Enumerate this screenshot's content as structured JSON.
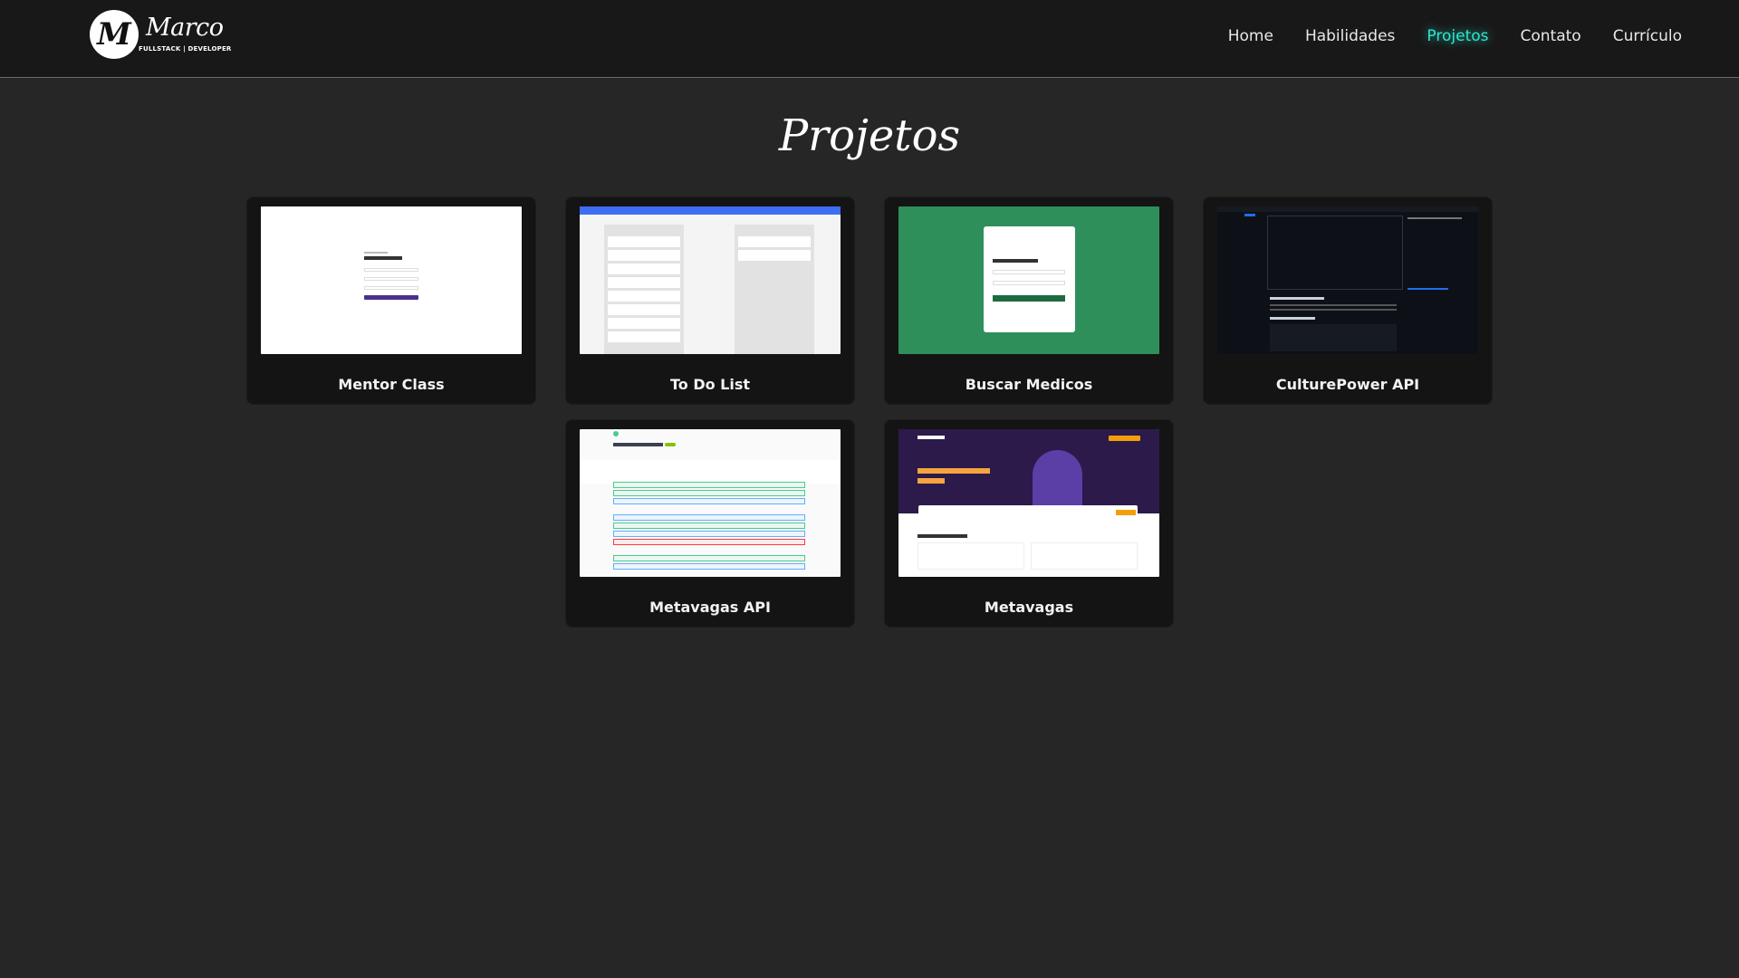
{
  "header": {
    "logo": {
      "monogram": "M",
      "name": "Marco",
      "tagline": "FULLSTACK | DEVELOPER"
    },
    "nav": [
      {
        "label": "Home",
        "active": false
      },
      {
        "label": "Habilidades",
        "active": false
      },
      {
        "label": "Projetos",
        "active": true
      },
      {
        "label": "Contato",
        "active": false
      },
      {
        "label": "Currículo",
        "active": false
      }
    ]
  },
  "section": {
    "title": "Projetos"
  },
  "projects": [
    {
      "title": "Mentor Class",
      "thumb": "white login page"
    },
    {
      "title": "To Do List",
      "thumb": "blue header kanban board"
    },
    {
      "title": "Buscar Medicos",
      "thumb": "green login page"
    },
    {
      "title": "CulturePower API",
      "thumb": "dark github repository"
    },
    {
      "title": "Metavagas API",
      "thumb": "swagger api docs"
    },
    {
      "title": "Metavagas",
      "thumb": "purple job portal"
    }
  ],
  "colors": {
    "background": "#262626",
    "navbar": "#181818",
    "card": "#141414",
    "accent": "#2ee6cf"
  }
}
